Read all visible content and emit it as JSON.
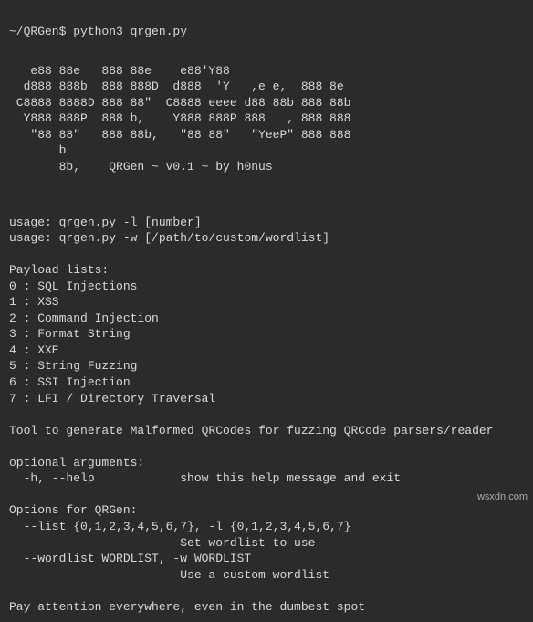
{
  "prompt": "~/QRGen$ python3 qrgen.py",
  "ascii_art": "   e88 88e   888 88e    e88'Y88\n  d888 888b  888 888D  d888  'Y   ,e e,  888 8e\n C8888 8888D 888 88\"  C8888 eeee d88 88b 888 88b\n  Y888 888P  888 b,    Y888 888P 888   , 888 888\n   \"88 88\"   888 88b,   \"88 88\"   \"YeeP\" 888 888\n       b\n       8b,    QRGen ~ v0.1 ~ by h0nus",
  "usage1": "usage: qrgen.py -l [number]",
  "usage2": "usage: qrgen.py -w [/path/to/custom/wordlist]",
  "payload_header": "Payload lists:",
  "payloads": [
    "0 : SQL Injections",
    "1 : XSS",
    "2 : Command Injection",
    "3 : Format String",
    "4 : XXE",
    "5 : String Fuzzing",
    "6 : SSI Injection",
    "7 : LFI / Directory Traversal"
  ],
  "description": "Tool to generate Malformed QRCodes for fuzzing QRCode parsers/reader",
  "optional_header": "optional arguments:",
  "optional_help": "  -h, --help            show this help message and exit",
  "options_header": "Options for QRGen:",
  "options_list": "  --list {0,1,2,3,4,5,6,7}, -l {0,1,2,3,4,5,6,7}\n                        Set wordlist to use",
  "options_wordlist": "  --wordlist WORDLIST, -w WORDLIST\n                        Use a custom wordlist",
  "footer": "Pay attention everywhere, even in the dumbest spot",
  "watermark": "wsxdn.com"
}
